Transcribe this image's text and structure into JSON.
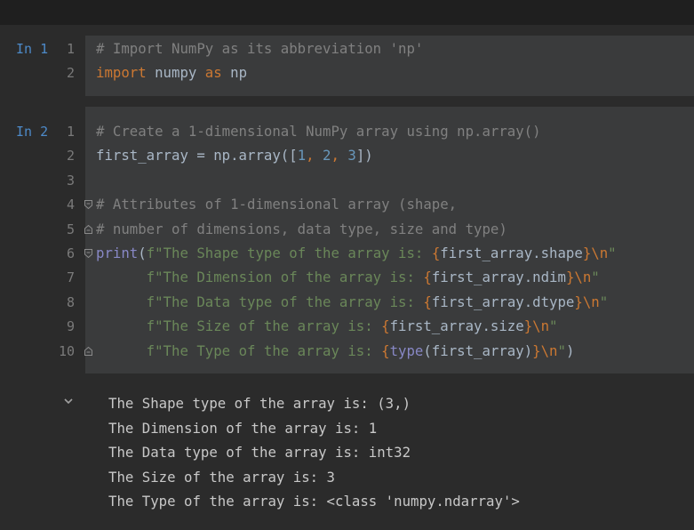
{
  "cells": [
    {
      "prompt": "In 1",
      "lines": [
        {
          "n": "1",
          "parts": [
            {
              "t": "# Import NumPy as its abbreviation 'np'",
              "c": "cm"
            }
          ]
        },
        {
          "n": "2",
          "parts": [
            {
              "t": "import",
              "c": "kw"
            },
            {
              "t": " numpy ",
              "c": ""
            },
            {
              "t": "as",
              "c": "kw"
            },
            {
              "t": " np",
              "c": ""
            }
          ]
        }
      ]
    },
    {
      "prompt": "In 2",
      "lines": [
        {
          "n": "1",
          "parts": [
            {
              "t": "# Create a 1-dimensional NumPy array using np.array()",
              "c": "cm"
            }
          ]
        },
        {
          "n": "2",
          "parts": [
            {
              "t": "first_array = np.array([",
              "c": ""
            },
            {
              "t": "1",
              "c": "num"
            },
            {
              "t": ", ",
              "c": "br"
            },
            {
              "t": "2",
              "c": "num"
            },
            {
              "t": ", ",
              "c": "br"
            },
            {
              "t": "3",
              "c": "num"
            },
            {
              "t": "])",
              "c": ""
            }
          ]
        },
        {
          "n": "3",
          "parts": []
        },
        {
          "n": "4",
          "fold": "open",
          "parts": [
            {
              "t": "# Attributes of 1-dimensional array (shape,",
              "c": "cm"
            }
          ]
        },
        {
          "n": "5",
          "fold": "close",
          "parts": [
            {
              "t": "# number of dimensions, data type, size and type)",
              "c": "cm"
            }
          ]
        },
        {
          "n": "6",
          "fold": "open",
          "parts": [
            {
              "t": "print",
              "c": "bi"
            },
            {
              "t": "(",
              "c": ""
            },
            {
              "t": "f\"The Shape type of the array is: ",
              "c": "str"
            },
            {
              "t": "{",
              "c": "br"
            },
            {
              "t": "first_array.shape",
              "c": ""
            },
            {
              "t": "}\\n",
              "c": "br"
            },
            {
              "t": "\"",
              "c": "str"
            }
          ]
        },
        {
          "n": "7",
          "parts": [
            {
              "t": "      ",
              "c": ""
            },
            {
              "t": "f\"The Dimension of the array is: ",
              "c": "str"
            },
            {
              "t": "{",
              "c": "br"
            },
            {
              "t": "first_array.ndim",
              "c": ""
            },
            {
              "t": "}\\n",
              "c": "br"
            },
            {
              "t": "\"",
              "c": "str"
            }
          ]
        },
        {
          "n": "8",
          "parts": [
            {
              "t": "      ",
              "c": ""
            },
            {
              "t": "f\"The Data type of the array is: ",
              "c": "str"
            },
            {
              "t": "{",
              "c": "br"
            },
            {
              "t": "first_array.dtype",
              "c": ""
            },
            {
              "t": "}\\n",
              "c": "br"
            },
            {
              "t": "\"",
              "c": "str"
            }
          ]
        },
        {
          "n": "9",
          "parts": [
            {
              "t": "      ",
              "c": ""
            },
            {
              "t": "f\"The Size of the array is: ",
              "c": "str"
            },
            {
              "t": "{",
              "c": "br"
            },
            {
              "t": "first_array.size",
              "c": ""
            },
            {
              "t": "}\\n",
              "c": "br"
            },
            {
              "t": "\"",
              "c": "str"
            }
          ]
        },
        {
          "n": "10",
          "fold": "close",
          "parts": [
            {
              "t": "      ",
              "c": ""
            },
            {
              "t": "f\"The Type of the array is: ",
              "c": "str"
            },
            {
              "t": "{",
              "c": "br"
            },
            {
              "t": "type",
              "c": "bi"
            },
            {
              "t": "(first_array)",
              "c": ""
            },
            {
              "t": "}\\n",
              "c": "br"
            },
            {
              "t": "\"",
              "c": "str"
            },
            {
              "t": ")",
              "c": ""
            }
          ]
        }
      ]
    }
  ],
  "output": {
    "collapse_icon": "chevron-down-icon",
    "lines": [
      "The Shape type of the array is: (3,)",
      "The Dimension of the array is: 1",
      "The Data type of the array is: int32",
      "The Size of the array is: 3",
      "The Type of the array is: <class 'numpy.ndarray'>"
    ]
  }
}
